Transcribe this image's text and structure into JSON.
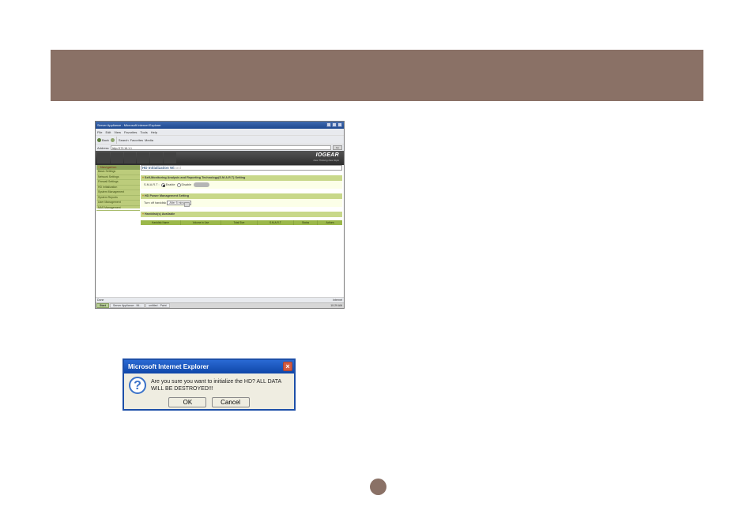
{
  "browser": {
    "window_title": "Server Appliance - Microsoft Internet Explorer",
    "menu": [
      "File",
      "Edit",
      "View",
      "Favorites",
      "Tools",
      "Help"
    ],
    "toolbar": {
      "back": "Back",
      "search": "Search",
      "favorites": "Favorites",
      "media": "Media"
    },
    "address_label": "Address",
    "address_value": "http://172.16.1.1",
    "go": "Go",
    "status_done": "Done",
    "status_zone": "Internet",
    "taskbar": {
      "start": "Start",
      "task1": "Server Appliance - Mi...",
      "task2": "untitled - Paint",
      "clock": "10:29 AM"
    }
  },
  "brand": {
    "name": "IOGEAR",
    "tagline": "New Thinking New Style"
  },
  "nav": {
    "header": "Navigation",
    "items": [
      "Basic Settings",
      "Network Settings",
      "Firewall Settings",
      "HD Initialization",
      "System Management",
      "System Reports",
      "User Management",
      "NAS Management"
    ]
  },
  "page": {
    "title_main": "HD Initialization Wi",
    "title_fade": "zard",
    "section_smart_title": "Self-Monitoring Analysis and Reporting Technology(S.M.A.R.T) Setting",
    "smart_label": "S.M.A.R.T :",
    "smart_enable": "Enable",
    "smart_disable": "Disable",
    "section_power_title": "HD Power Management Setting",
    "power_label": "Turn off harddisk",
    "power_value": "After 5 mins",
    "section_avail_title": "Harddisk(s) Available",
    "columns": [
      "Harddisk Name",
      "Volume in Use",
      "Total Size",
      "S.M.A.R.T",
      "Status",
      "Actions"
    ]
  },
  "modal": {
    "title": "Microsoft Internet Explorer",
    "text": "Are you sure you want to initialize the HD? ALL DATA WILL BE DESTROYED!!!",
    "ok": "OK",
    "cancel": "Cancel"
  }
}
